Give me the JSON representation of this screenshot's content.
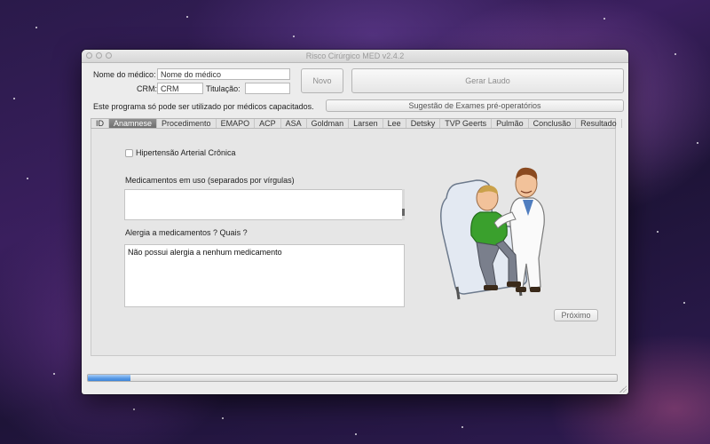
{
  "window": {
    "title": "Risco Cirúrgico MED v2.4.2"
  },
  "form": {
    "nome_label": "Nome do médico:",
    "nome_value": "Nome do médico",
    "crm_label": "CRM:",
    "crm_value": "CRM",
    "titulacao_label": "Titulação:",
    "titulacao_value": "",
    "disclaimer": "Este programa só pode ser utilizado por médicos capacitados."
  },
  "buttons": {
    "novo": "Novo",
    "gerar_laudo": "Gerar Laudo",
    "sugestao": "Sugestão de Exames pré-operatórios",
    "proximo": "Próximo"
  },
  "tabs": [
    {
      "label": "ID"
    },
    {
      "label": "Anamnese",
      "active": true
    },
    {
      "label": "Procedimento"
    },
    {
      "label": "EMAPO"
    },
    {
      "label": "ACP"
    },
    {
      "label": "ASA"
    },
    {
      "label": "Goldman"
    },
    {
      "label": "Larsen"
    },
    {
      "label": "Lee"
    },
    {
      "label": "Detsky"
    },
    {
      "label": "TVP Geerts"
    },
    {
      "label": "Pulmão"
    },
    {
      "label": "Conclusão"
    },
    {
      "label": "Resultado"
    }
  ],
  "anamnese": {
    "hipertensao_label": "Hipertensão Arterial Crônica",
    "hipertensao_checked": false,
    "medicamentos_label": "Medicamentos em uso (separados por vírgulas)",
    "medicamentos_value": "",
    "alergia_label": "Alergia a medicamentos ? Quais ?",
    "alergia_value": "Não possui alergia a nenhum medicamento"
  },
  "progress": {
    "value": 0.08
  },
  "colors": {
    "progress_fill": "#5a9be6",
    "active_tab": "#7d7d7d",
    "doctor_coat": "#ffffff",
    "patient_shirt": "#3aa02d",
    "chair": "#dfe6f0"
  },
  "illustration": {
    "icon": "doctor-and-patient-illustration"
  }
}
